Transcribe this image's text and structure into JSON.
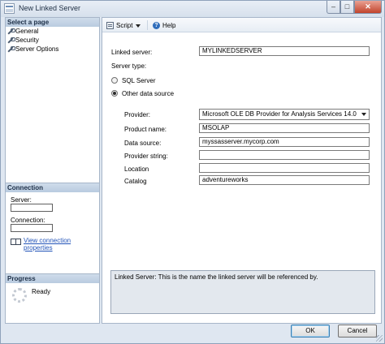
{
  "window": {
    "title": "New Linked Server",
    "controls": {
      "minimize": "–",
      "maximize": "□",
      "close": "✕"
    }
  },
  "sidebar": {
    "select_page_header": "Select a page",
    "pages": [
      {
        "label": "General",
        "icon": "wrench-icon"
      },
      {
        "label": "Security",
        "icon": "wrench-icon"
      },
      {
        "label": "Server Options",
        "icon": "wrench-icon"
      }
    ],
    "connection": {
      "header": "Connection",
      "server_label": "Server:",
      "server_value": "",
      "connection_label": "Connection:",
      "connection_value": "",
      "view_link": "View connection properties"
    },
    "progress": {
      "header": "Progress",
      "status": "Ready"
    }
  },
  "toolbar": {
    "script_label": "Script",
    "help_label": "Help"
  },
  "form": {
    "linked_server_label": "Linked server:",
    "linked_server_value": "MYLINKEDSERVER",
    "server_type_label": "Server type:",
    "sql_server_label": "SQL Server",
    "other_source_label": "Other data source",
    "server_type_selected": "Other data source",
    "provider_label": "Provider:",
    "provider_value": "Microsoft OLE DB Provider for Analysis Services 14.0",
    "product_name_label": "Product name:",
    "product_name_value": "MSOLAP",
    "data_source_label": "Data source:",
    "data_source_value": "myssasserver.mycorp.com",
    "provider_string_label": "Provider string:",
    "provider_string_value": "",
    "location_label": "Location",
    "location_value": "",
    "catalog_label": "Catalog",
    "catalog_value": "adventureworks"
  },
  "description": "Linked Server: This is the name the linked server will be referenced by.",
  "buttons": {
    "ok": "OK",
    "cancel": "Cancel"
  }
}
